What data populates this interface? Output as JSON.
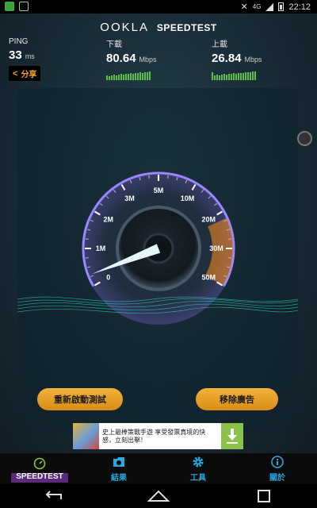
{
  "status_bar": {
    "time": "22:12"
  },
  "app": {
    "logo_prefix": "OOKLA",
    "logo_name": "SPEEDTEST"
  },
  "metrics": {
    "ping": {
      "label": "PING",
      "value": "33",
      "unit": "ms"
    },
    "download": {
      "label": "下載",
      "value": "80.64",
      "unit": "Mbps"
    },
    "upload": {
      "label": "上載",
      "value": "26.84",
      "unit": "Mbps"
    }
  },
  "share": {
    "label": "分享",
    "icon": "share-icon"
  },
  "gauge": {
    "ticks": [
      "0",
      "1M",
      "2M",
      "3M",
      "5M",
      "10M",
      "20M",
      "30M",
      "50M"
    ],
    "needle_mbps": 0.3,
    "accent": "#ff8c1a",
    "ring": "#9b86ff"
  },
  "buttons": {
    "restart": "重新啟動測試",
    "remove_ads": "移除廣告"
  },
  "ad": {
    "text": "史上最棒策戰手遊 享受發票真境的快感，立刻出擊！"
  },
  "tabs": [
    {
      "label": "SPEEDTEST",
      "icon": "speedometer-icon",
      "active": true
    },
    {
      "label": "結果",
      "icon": "results-icon"
    },
    {
      "label": "工具",
      "icon": "gear-icon"
    },
    {
      "label": "關於",
      "icon": "info-icon"
    }
  ]
}
